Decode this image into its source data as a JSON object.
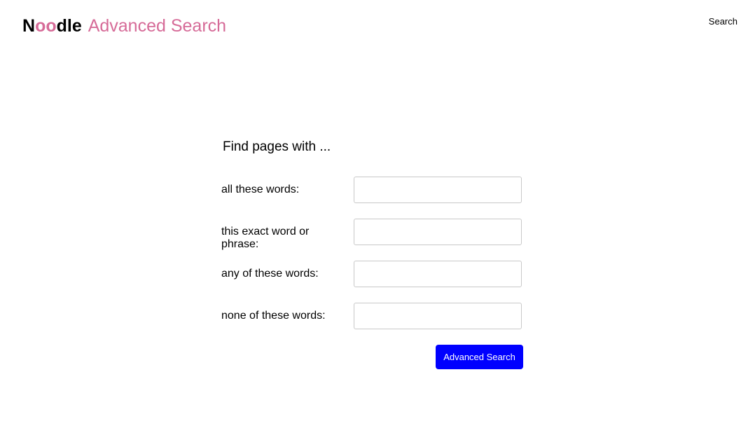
{
  "header": {
    "brand": {
      "letters": [
        "N",
        "o",
        "o",
        "dle"
      ]
    },
    "subtitle": "Advanced Search",
    "search_link": "Search"
  },
  "colors": {
    "accent_pink": "#d66b98",
    "button_blue": "#0000ff"
  },
  "form": {
    "heading": "Find pages with ...",
    "fields": [
      {
        "label": "all these words:",
        "value": "",
        "placeholder": ""
      },
      {
        "label": "this exact word or phrase:",
        "value": "",
        "placeholder": ""
      },
      {
        "label": "any of these words:",
        "value": "",
        "placeholder": ""
      },
      {
        "label": "none of these words:",
        "value": "",
        "placeholder": ""
      }
    ],
    "submit_label": "Advanced Search"
  }
}
